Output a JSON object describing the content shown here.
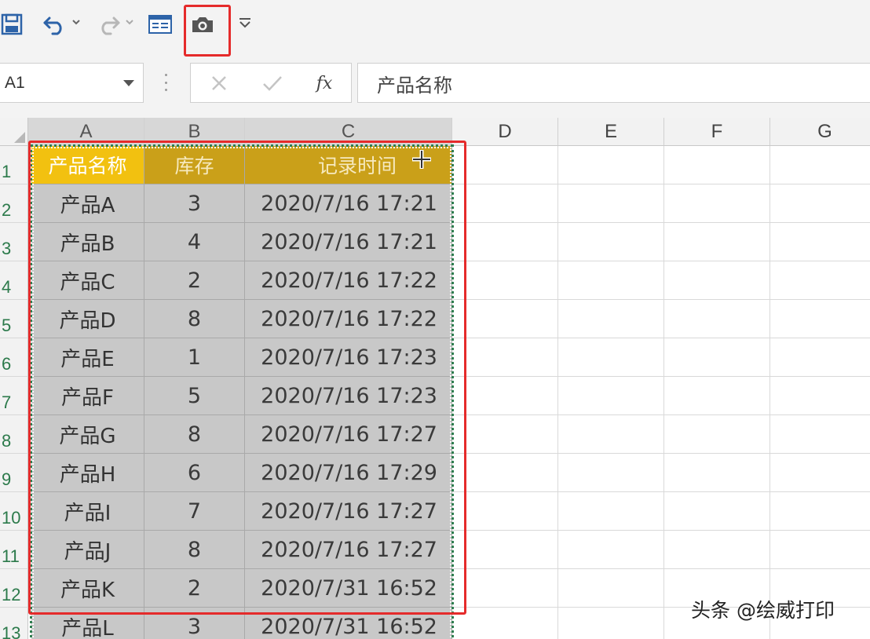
{
  "formula_bar": {
    "cell_ref": "A1",
    "fx_label": "fx",
    "content": "产品名称"
  },
  "columns": [
    "A",
    "B",
    "C",
    "D",
    "E",
    "F",
    "G"
  ],
  "rows": [
    "1",
    "2",
    "3",
    "4",
    "5",
    "6",
    "7",
    "8",
    "9",
    "10",
    "11",
    "12",
    "13"
  ],
  "table": {
    "headers": [
      "产品名称",
      "库存",
      "记录时间"
    ],
    "records": [
      [
        "产品A",
        "3",
        "2020/7/16 17:21"
      ],
      [
        "产品B",
        "4",
        "2020/7/16 17:21"
      ],
      [
        "产品C",
        "2",
        "2020/7/16 17:22"
      ],
      [
        "产品D",
        "8",
        "2020/7/16 17:22"
      ],
      [
        "产品E",
        "1",
        "2020/7/16 17:23"
      ],
      [
        "产品F",
        "5",
        "2020/7/16 17:23"
      ],
      [
        "产品G",
        "8",
        "2020/7/16 17:27"
      ],
      [
        "产品H",
        "6",
        "2020/7/16 17:29"
      ],
      [
        "产品I",
        "7",
        "2020/7/16 17:27"
      ],
      [
        "产品J",
        "8",
        "2020/7/16 17:27"
      ],
      [
        "产品K",
        "2",
        "2020/7/31 16:52"
      ],
      [
        "产品L",
        "3",
        "2020/7/31 16:52"
      ]
    ]
  },
  "colors": {
    "highlight": "#e52b2b",
    "header_fill": "#caa019",
    "active_header_fill": "#f2c110",
    "selection_fill": "#c8c8c8",
    "row_number": "#2c7a4b"
  },
  "watermark": "头条 @绘威打印"
}
